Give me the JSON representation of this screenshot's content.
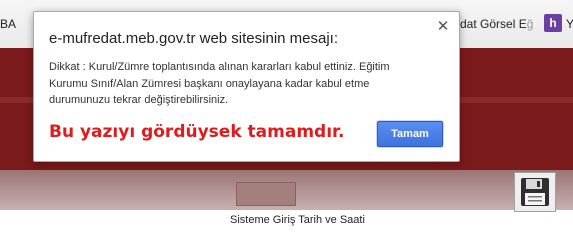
{
  "bookmarks": {
    "left_fragment": "BA",
    "right_label": "dat Görsel E",
    "right_label_faded": "ğ",
    "h_icon": "h-icon",
    "y_fragment": "Y"
  },
  "dialog": {
    "title": "e-mufredat.meb.gov.tr web sitesinin mesajı:",
    "close_icon": "close-icon",
    "message_line1": "Dikkat : Kurul/Zümre toplantısında alınan kararları kabul ettiniz. Eğitim",
    "message_line2": "Kurumu Sınıf/Alan Zümresi başkanı onaylayana kadar kabul etme",
    "message_line3": "durumunuzu tekrar değiştirebilirsiniz.",
    "ok_label": "Tamam"
  },
  "annotation": {
    "text": "Bu yazıyı gördüysek tamamdır.",
    "color": "#e01b1b"
  },
  "page": {
    "save_icon": "floppy-disk-icon",
    "footer_label": "Sisteme Giriş Tarih ve Saati",
    "band_color": "#7b1a1c"
  }
}
